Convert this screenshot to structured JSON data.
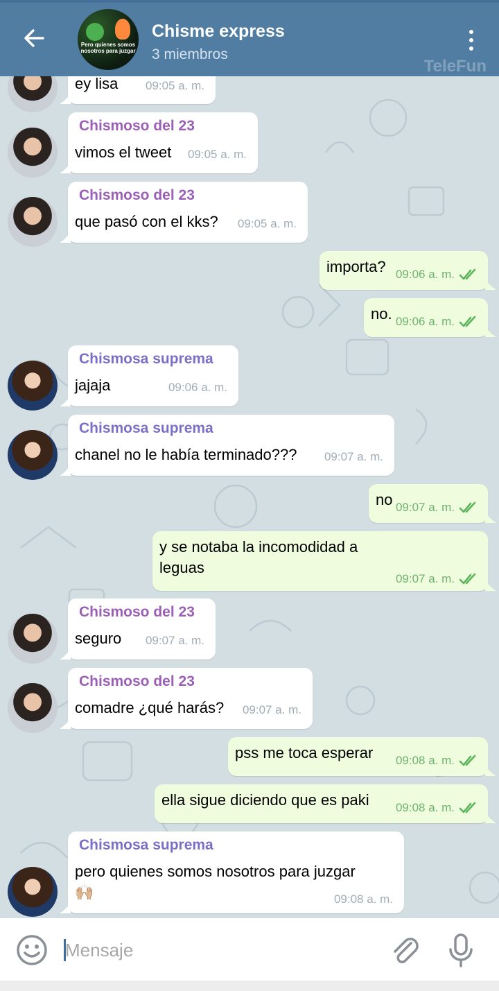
{
  "header": {
    "title": "Chisme express",
    "subtitle": "3 miembros",
    "watermark": "TeleFun",
    "group_avatar_caption": "Pero quienes somos nosotros para juzgar"
  },
  "colors": {
    "header_bg": "#517da2",
    "chat_bg": "#d3dee2",
    "incoming_bubble": "#ffffff",
    "outgoing_bubble": "#effdde",
    "sender_chismoso": "#9b5fb5",
    "sender_chismosa": "#7a6fc6",
    "read_check": "#5cb55c"
  },
  "icons": {
    "back": "arrow-left-icon",
    "menu": "more-vertical-icon",
    "emoji": "smile-icon",
    "attach": "paperclip-icon",
    "voice": "microphone-icon",
    "read": "double-check-icon"
  },
  "messages": [
    {
      "side": "in",
      "sender": "",
      "text": [
        "ey lisa"
      ],
      "time": "09:05 a. m."
    },
    {
      "side": "in",
      "sender": "Chismoso del 23",
      "text": [
        "vimos el tweet"
      ],
      "time": "09:05 a. m."
    },
    {
      "side": "in",
      "sender": "Chismoso del 23",
      "text": [
        "que pasó con el kks?"
      ],
      "time": "09:05 a. m."
    },
    {
      "side": "out",
      "text": [
        "importa?"
      ],
      "time": "09:06 a. m."
    },
    {
      "side": "out",
      "text": [
        "no."
      ],
      "time": "09:06 a. m."
    },
    {
      "side": "in",
      "sender": "Chismosa suprema",
      "text": [
        "jajaja"
      ],
      "time": "09:06 a. m."
    },
    {
      "side": "in",
      "sender": "Chismosa suprema",
      "text": [
        "chanel no le había terminado???"
      ],
      "time": "09:07 a. m."
    },
    {
      "side": "out",
      "text": [
        "no"
      ],
      "time": "09:07 a. m."
    },
    {
      "side": "out",
      "text": [
        "y se notaba la incomodidad a",
        "leguas"
      ],
      "time": "09:07 a. m."
    },
    {
      "side": "in",
      "sender": "Chismoso del 23",
      "text": [
        "seguro"
      ],
      "time": "09:07 a. m."
    },
    {
      "side": "in",
      "sender": "Chismoso del 23",
      "text": [
        "comadre ¿qué harás?"
      ],
      "time": "09:07 a. m."
    },
    {
      "side": "out",
      "text": [
        "pss me toca esperar"
      ],
      "time": "09:08 a. m."
    },
    {
      "side": "out",
      "text": [
        "ella sigue diciendo que es paki"
      ],
      "time": "09:08 a. m."
    },
    {
      "side": "in",
      "sender": "Chismosa suprema",
      "text": [
        "pero quienes somos nosotros para juzgar",
        "🙌🏼"
      ],
      "time": "09:08 a. m."
    }
  ],
  "composer": {
    "placeholder": "Mensaje"
  }
}
